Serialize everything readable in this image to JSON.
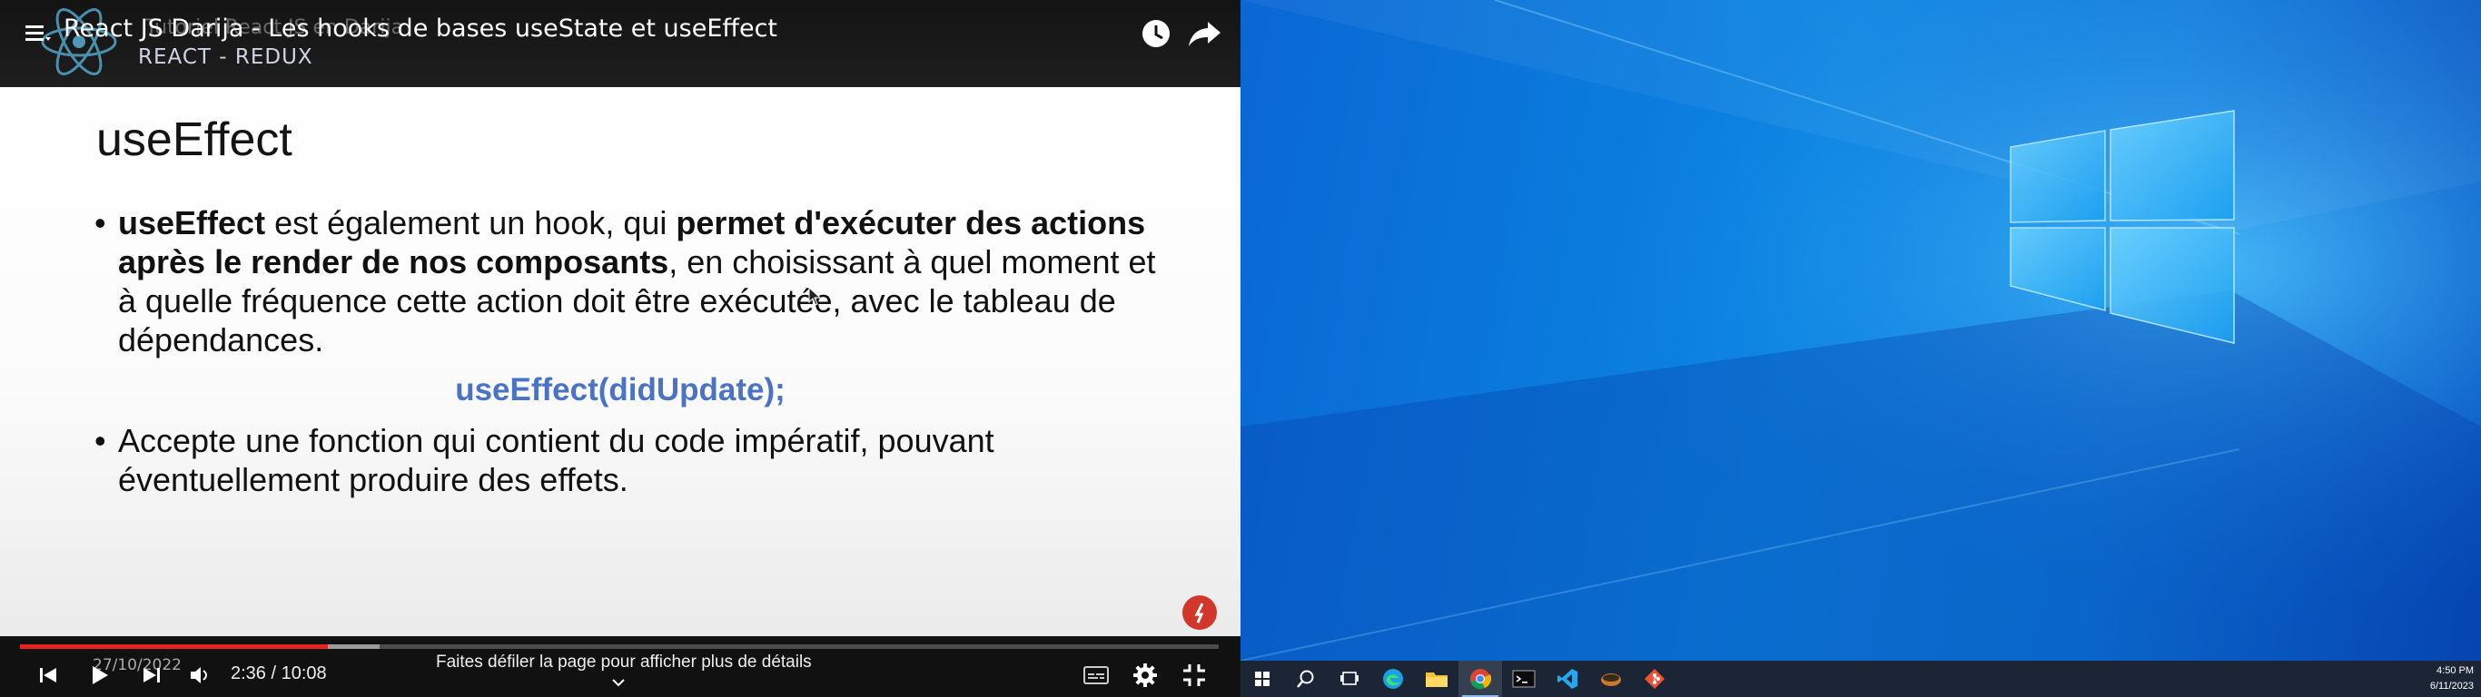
{
  "video": {
    "title": "React JS Darija - Les hooks de bases useState et useEffect",
    "title_ghost": "Tutoriel React JS en Darija",
    "subtitle": "REACT - REDUX",
    "menu_icon": "hamburger-menu-icon",
    "header_icons": [
      "watch-later-icon",
      "share-icon"
    ]
  },
  "slide": {
    "heading": "useEffect",
    "bullet_glyph": "•",
    "bullet1": {
      "b1": "useEffect",
      "t1": " est également un hook, qui ",
      "b2": "permet d'exécuter des actions après le render de nos composants",
      "t2": ", en choisissant à quel moment et à quelle fréquence cette action doit être exécutée, avec le tableau de dépendances."
    },
    "code": "useEffect(didUpdate);",
    "bullet2": "Accepte une fonction qui contient du code impératif, pouvant éventuellement produire des effets."
  },
  "player": {
    "progress_fraction": 0.257,
    "buffered_fraction": 0.3,
    "progress_date": "27/10/2022",
    "time": "2:36 / 10:08",
    "scroll_hint": "Faites défiler la page pour afficher plus de détails",
    "accent": "#e52420"
  },
  "taskbar": {
    "apps": [
      "start-icon",
      "search-icon",
      "task-view-icon",
      "edge-icon",
      "file-explorer-icon",
      "chrome-icon",
      "terminal-icon",
      "vscode-icon",
      "app-icon",
      "git-icon"
    ],
    "active_app": "chrome-icon",
    "clock_time": "4:50 PM",
    "clock_date": "6/11/2023"
  }
}
